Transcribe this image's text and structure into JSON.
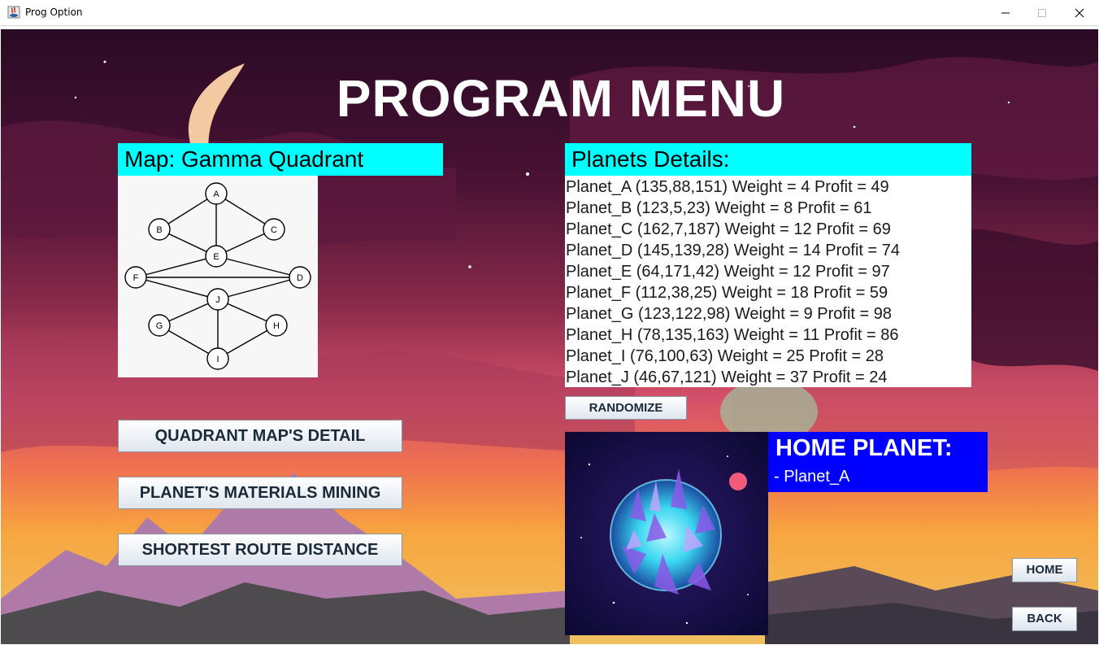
{
  "window": {
    "title": "Prog Option"
  },
  "page": {
    "heading": "PROGRAM MENU"
  },
  "map": {
    "label": "Map: Gamma Quadrant",
    "nodes": [
      "A",
      "B",
      "C",
      "E",
      "F",
      "D",
      "J",
      "G",
      "H",
      "I"
    ]
  },
  "planets": {
    "label": "Planets Details:",
    "rows": [
      "Planet_A (135,88,151) Weight = 4 Profit = 49",
      "Planet_B (123,5,23) Weight = 8 Profit = 61",
      "Planet_C (162,7,187) Weight = 12 Profit = 69",
      "Planet_D (145,139,28) Weight = 14 Profit = 74",
      "Planet_E (64,171,42) Weight = 12 Profit = 97",
      "Planet_F (112,38,25) Weight = 18 Profit = 59",
      "Planet_G (123,122,98) Weight = 9 Profit = 98",
      "Planet_H (78,135,163) Weight = 11 Profit = 86",
      "Planet_I (76,100,63) Weight = 25 Profit = 28",
      "Planet_J (46,67,121) Weight = 37 Profit = 24"
    ]
  },
  "buttons": {
    "randomize": "RANDOMIZE",
    "quadrant_map_detail": "QUADRANT MAP'S DETAIL",
    "materials_mining": "PLANET'S MATERIALS MINING",
    "shortest_route": "SHORTEST ROUTE DISTANCE",
    "home": "HOME",
    "back": "BACK"
  },
  "home_planet": {
    "title": "HOME PLANET:",
    "value": "- Planet_A"
  },
  "colors": {
    "label_bar": "#00ffff",
    "home_panel": "#0000ff",
    "heading_text": "#ffffff"
  }
}
